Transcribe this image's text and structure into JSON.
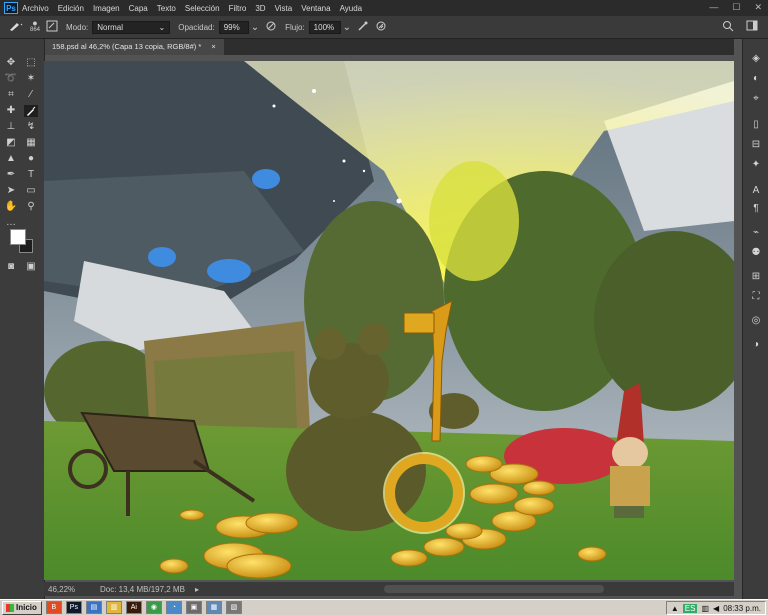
{
  "app": {
    "logo": "Ps"
  },
  "menu": [
    "Archivo",
    "Edición",
    "Imagen",
    "Capa",
    "Texto",
    "Selección",
    "Filtro",
    "3D",
    "Vista",
    "Ventana",
    "Ayuda"
  ],
  "window_controls": {
    "minimize": "—",
    "maximize": "☐",
    "close": "✕"
  },
  "options_bar": {
    "brush_size": "864",
    "mode_label": "Modo:",
    "mode_value": "Normal",
    "opacity_label": "Opacidad:",
    "opacity_value": "99%",
    "flow_label": "Flujo:",
    "flow_value": "100%"
  },
  "document_tab": {
    "title": "158.psd al 46,2% (Capa 13 copia, RGB/8#) *",
    "close": "×"
  },
  "status_bar": {
    "zoom": "46,22%",
    "doc_info": "Doc: 13,4 MB/197,2 MB",
    "arrow": "▸"
  },
  "taskbar": {
    "start_label": "Inicio",
    "clock": "08:33 p.m.",
    "apps": [
      {
        "name": "brave",
        "color": "#e24a22",
        "glyph": "B"
      },
      {
        "name": "ps",
        "color": "#0d1a2b",
        "glyph": "Ps"
      },
      {
        "name": "explorer",
        "color": "#3b73c4",
        "glyph": "▤"
      },
      {
        "name": "folder",
        "color": "#e0b63c",
        "glyph": "▥"
      },
      {
        "name": "ai",
        "color": "#3a1a0a",
        "glyph": "Ai"
      },
      {
        "name": "chrome",
        "color": "#3a9a48",
        "glyph": "◉"
      },
      {
        "name": "app7",
        "color": "#4a89c7",
        "glyph": "◔"
      },
      {
        "name": "app8",
        "color": "#6b6b6b",
        "glyph": "▣"
      },
      {
        "name": "app9",
        "color": "#5f88b5",
        "glyph": "▦"
      },
      {
        "name": "app10",
        "color": "#777777",
        "glyph": "▧"
      }
    ]
  },
  "colors": {
    "accent": "#31a8ff",
    "gold": "#e0a820",
    "light_beam": "#fff64a"
  }
}
